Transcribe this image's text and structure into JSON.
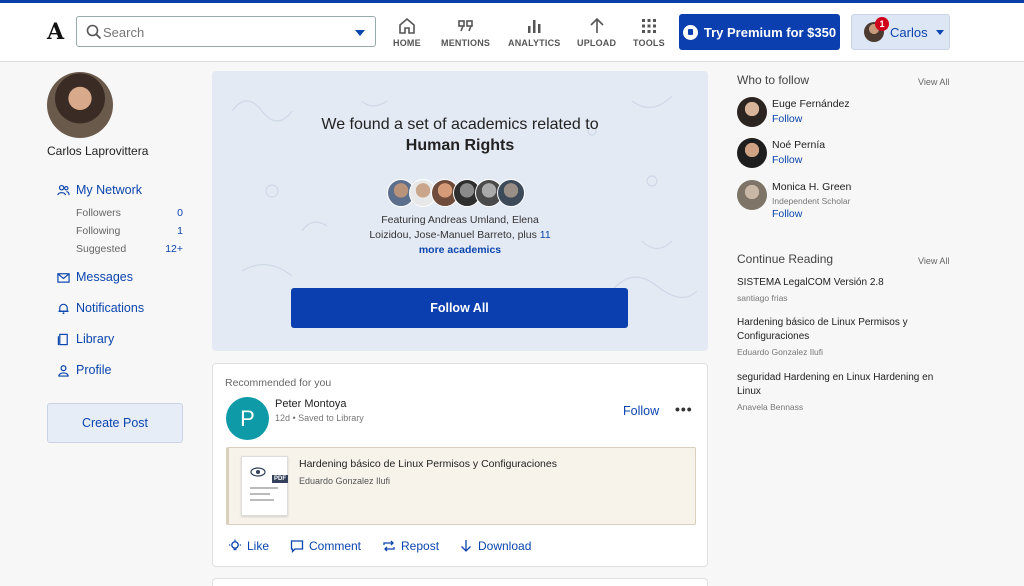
{
  "header": {
    "logo": "A",
    "search_placeholder": "Search",
    "nav": [
      {
        "label": "HOME",
        "icon": "home-icon"
      },
      {
        "label": "MENTIONS",
        "icon": "quote-icon"
      },
      {
        "label": "ANALYTICS",
        "icon": "bar-chart-icon"
      },
      {
        "label": "UPLOAD",
        "icon": "upload-arrow-icon"
      },
      {
        "label": "TOOLS",
        "icon": "grid-icon"
      }
    ],
    "premium_label": "Try Premium for $350",
    "user_label": "Carlos",
    "notification_count": "1"
  },
  "sidebar": {
    "profile_name": "Carlos Laprovittera",
    "my_network": "My Network",
    "stats": [
      {
        "label": "Followers",
        "value": "0"
      },
      {
        "label": "Following",
        "value": "1"
      },
      {
        "label": "Suggested",
        "value": "12+"
      }
    ],
    "links": [
      "Messages",
      "Notifications",
      "Library",
      "Profile"
    ],
    "create_post": "Create Post"
  },
  "banner": {
    "title": "We found a set of academics related to",
    "topic": "Human Rights",
    "featuring_text": "Featuring Andreas Umland, Elena Loizidou, Jose-Manuel Barreto, plus",
    "featuring_count": "11",
    "featuring_more": "more academics",
    "follow_all": "Follow All"
  },
  "recommended": {
    "label": "Recommended for you",
    "avatar_letter": "P",
    "author": "Peter Montoya",
    "meta": "12d • Saved to Library",
    "follow": "Follow",
    "more": "•••",
    "doc_title": "Hardening básico de Linux Permisos y Configuraciones",
    "doc_author": "Eduardo Gonzalez Ilufi",
    "pdf_tag": "PDF",
    "actions": [
      "Like",
      "Comment",
      "Repost",
      "Download"
    ]
  },
  "who_to_follow": {
    "heading": "Who to follow",
    "view_all": "View All",
    "people": [
      {
        "name": "Euge Fernández",
        "subtitle": "",
        "follow": "Follow"
      },
      {
        "name": "Noé Pernía",
        "subtitle": "",
        "follow": "Follow"
      },
      {
        "name": "Monica H. Green",
        "subtitle": "Independent Scholar",
        "follow": "Follow"
      }
    ]
  },
  "continue_reading": {
    "heading": "Continue Reading",
    "view_all": "View All",
    "items": [
      {
        "title": "SISTEMA LegalCOM Versión 2.8",
        "author": "santiago frias"
      },
      {
        "title": "Hardening básico de Linux Permisos y Configuraciones",
        "author": "Eduardo Gonzalez Ilufi"
      },
      {
        "title": "seguridad Hardening en Linux Hardening en Linux",
        "author": "Anavela Bennass"
      }
    ]
  },
  "colors": {
    "brand_blue": "#0b3eae",
    "link_blue": "#0b45ad",
    "banner_bg": "#e4eaf4",
    "avatar_teal": "#0e9aa7"
  }
}
